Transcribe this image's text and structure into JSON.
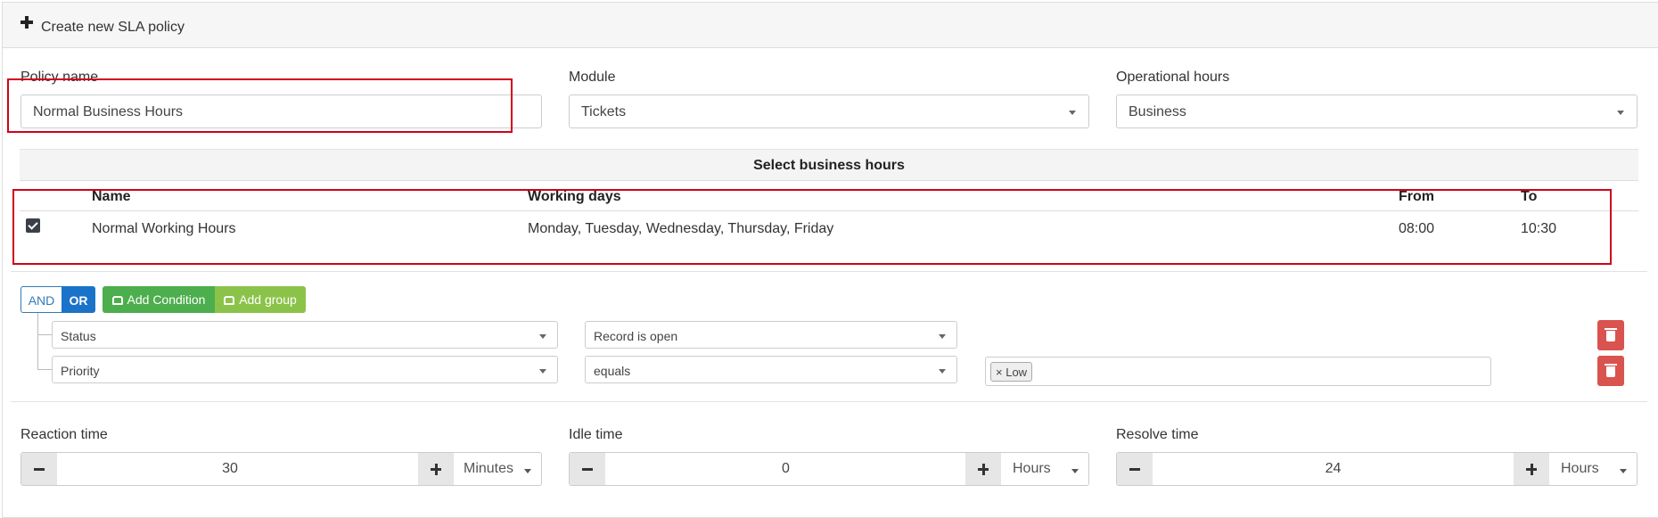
{
  "header": {
    "title": "Create new SLA policy"
  },
  "form": {
    "policy_name_label": "Policy name",
    "policy_name_value": "Normal Business Hours",
    "module_label": "Module",
    "module_value": "Tickets",
    "operational_label": "Operational hours",
    "operational_value": "Business"
  },
  "business_hours": {
    "title": "Select business hours",
    "columns": {
      "name": "Name",
      "days": "Working days",
      "from": "From",
      "to": "To"
    },
    "rows": [
      {
        "checked": true,
        "name": "Normal Working Hours",
        "days": "Monday, Tuesday, Wednesday, Thursday, Friday",
        "from": "08:00",
        "to": "10:30"
      }
    ]
  },
  "conditions": {
    "and_label": "AND",
    "or_label": "OR",
    "add_condition_label": "Add Condition",
    "add_group_label": "Add group",
    "rules": [
      {
        "field": "Status",
        "operator": "Record is open",
        "value": ""
      },
      {
        "field": "Priority",
        "operator": "equals",
        "value": "Low"
      }
    ],
    "tag_remove": "×"
  },
  "times": {
    "reaction": {
      "label": "Reaction time",
      "value": "30",
      "unit": "Minutes"
    },
    "idle": {
      "label": "Idle time",
      "value": "0",
      "unit": "Hours"
    },
    "resolve": {
      "label": "Resolve time",
      "value": "24",
      "unit": "Hours"
    }
  },
  "colors": {
    "highlight": "#d0021b",
    "primary": "#1a73c8",
    "success": "#4cae4c",
    "danger": "#d9534f"
  }
}
